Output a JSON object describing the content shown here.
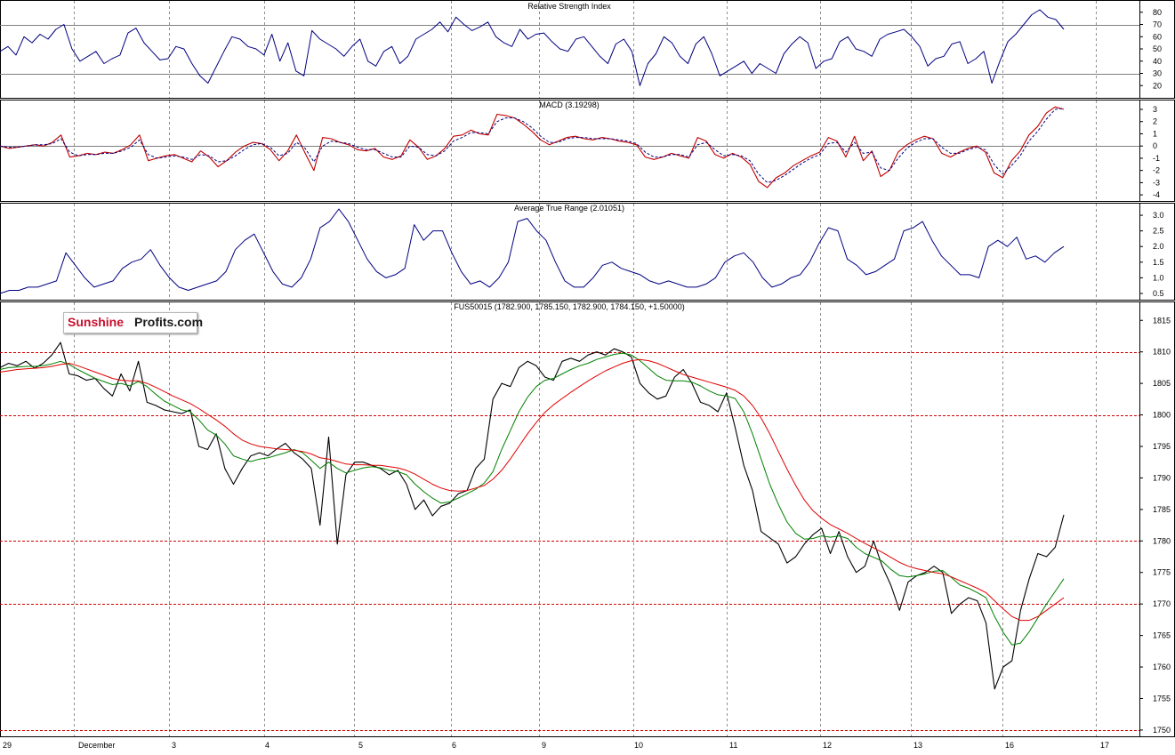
{
  "watermark": {
    "part1": "Sunshine",
    "part2": "Profits.com",
    "colors": {
      "part1": "#c8102e",
      "part2": "#1a1a1a"
    }
  },
  "colors": {
    "price": "#000000",
    "fast_ma": "#008000",
    "slow_ma": "#e00000",
    "indicator": "#000080",
    "signal": "#c00000",
    "ref_line": "#d00000",
    "grid": "#909090"
  },
  "chart_data": [
    {
      "type": "line",
      "title": "Relative Strength Index",
      "y_ticks": [
        "80",
        "70",
        "60",
        "50",
        "40",
        "30",
        "20"
      ],
      "ylim": [
        10,
        90
      ],
      "reference_lines": [
        70,
        30
      ],
      "series": [
        {
          "values": [
            48,
            52,
            45,
            60,
            55,
            62,
            58,
            66,
            70,
            50,
            40,
            44,
            48,
            38,
            42,
            45,
            63,
            67,
            55,
            48,
            41,
            42,
            52,
            50,
            38,
            28,
            22,
            35,
            48,
            60,
            58,
            52,
            50,
            45,
            62,
            40,
            55,
            32,
            28,
            65,
            58,
            54,
            50,
            44,
            52,
            58,
            40,
            36,
            48,
            52,
            38,
            44,
            58,
            62,
            66,
            72,
            64,
            76,
            70,
            65,
            68,
            72,
            60,
            55,
            52,
            66,
            58,
            62,
            63,
            56,
            50,
            48,
            58,
            60,
            52,
            44,
            38,
            54,
            58,
            48,
            20,
            38,
            46,
            60,
            55,
            44,
            38,
            54,
            60,
            46,
            28,
            32,
            36,
            40,
            30,
            38,
            34,
            30,
            46,
            54,
            60,
            55,
            34,
            40,
            42,
            56,
            60,
            50,
            48,
            44,
            58,
            62,
            64,
            66,
            60,
            52,
            36,
            42,
            44,
            54,
            56,
            38,
            42,
            48,
            22,
            40,
            56,
            62,
            70,
            78,
            82,
            76,
            74,
            66
          ]
        }
      ]
    },
    {
      "type": "line",
      "title": "MACD (3.19298)",
      "y_ticks": [
        "3",
        "2",
        "1",
        "0",
        "-1",
        "-2",
        "-3",
        "-4"
      ],
      "ylim": [
        -4.5,
        3.8
      ],
      "reference_lines": [
        0
      ],
      "series": [
        {
          "values": [
            0,
            -0.2,
            -0.1,
            0,
            0.1,
            0,
            0.3,
            0.9,
            -0.9,
            -0.8,
            -0.6,
            -0.7,
            -0.5,
            -0.6,
            -0.3,
            0.1,
            0.9,
            -1.2,
            -1.0,
            -0.8,
            -0.7,
            -1.0,
            -1.3,
            -0.4,
            -0.9,
            -1.7,
            -1.2,
            -0.5,
            0,
            0.3,
            0.2,
            -0.3,
            -1.2,
            -0.4,
            0.9,
            -0.6,
            -2.0,
            0.7,
            0.6,
            0.3,
            0.1,
            -0.3,
            -0.4,
            -0.2,
            -0.9,
            -1.1,
            -0.8,
            0.5,
            -0.1,
            -1.1,
            -0.8,
            -0.2,
            0.8,
            0.9,
            1.3,
            1.0,
            0.9,
            2.6,
            2.5,
            2.3,
            1.8,
            1.2,
            0.5,
            0.1,
            0.4,
            0.7,
            0.8,
            0.6,
            0.5,
            0.7,
            0.6,
            0.4,
            0.3,
            0.1,
            -0.9,
            -1.1,
            -0.9,
            -0.6,
            -0.8,
            -1.0,
            0.7,
            0.4,
            -0.7,
            -1.0,
            -0.6,
            -0.9,
            -1.5,
            -2.9,
            -3.4,
            -2.6,
            -2.2,
            -1.6,
            -1.2,
            -0.8,
            -0.5,
            0.7,
            0.4,
            -0.9,
            0.8,
            -1.2,
            -0.4,
            -2.5,
            -2.0,
            -0.5,
            0.1,
            0.5,
            0.8,
            0.6,
            -0.6,
            -0.9,
            -0.5,
            -0.2,
            0,
            -0.5,
            -2.2,
            -2.6,
            -1.2,
            -0.4,
            0.9,
            1.6,
            2.7,
            3.2,
            3.0
          ]
        },
        {
          "values": [
            0,
            -0.1,
            -0.1,
            0,
            0.1,
            0.1,
            0.2,
            0.6,
            -0.5,
            -0.8,
            -0.7,
            -0.7,
            -0.6,
            -0.6,
            -0.4,
            -0.1,
            0.5,
            -0.7,
            -1.0,
            -0.9,
            -0.8,
            -0.9,
            -1.1,
            -0.7,
            -0.8,
            -1.3,
            -1.2,
            -0.8,
            -0.3,
            0.1,
            0.2,
            -0.1,
            -0.8,
            -0.6,
            0.3,
            -0.2,
            -1.3,
            0,
            0.4,
            0.3,
            0.2,
            -0.1,
            -0.3,
            -0.3,
            -0.6,
            -0.9,
            -0.9,
            0,
            -0.1,
            -0.7,
            -0.8,
            -0.4,
            0.4,
            0.7,
            1.1,
            1.1,
            1.0,
            2.0,
            2.3,
            2.3,
            2.0,
            1.5,
            0.8,
            0.3,
            0.3,
            0.6,
            0.7,
            0.7,
            0.6,
            0.6,
            0.6,
            0.5,
            0.4,
            0.2,
            -0.5,
            -0.9,
            -0.9,
            -0.7,
            -0.7,
            -0.9,
            0.1,
            0.3,
            -0.3,
            -0.8,
            -0.7,
            -0.8,
            -1.2,
            -2.3,
            -3.0,
            -2.8,
            -2.4,
            -1.9,
            -1.4,
            -1.0,
            -0.7,
            0.2,
            0.3,
            -0.5,
            0.3,
            -0.6,
            -0.5,
            -1.8,
            -2.0,
            -1.0,
            -0.2,
            0.3,
            0.6,
            0.6,
            -0.1,
            -0.6,
            -0.6,
            -0.3,
            -0.1,
            -0.3,
            -1.5,
            -2.3,
            -1.6,
            -0.8,
            0.4,
            1.2,
            2.2,
            3.0,
            3.1
          ]
        }
      ]
    },
    {
      "type": "line",
      "title": "Average True Range (2.01051)",
      "y_ticks": [
        "3.0",
        "2.5",
        "2.0",
        "1.5",
        "1.0",
        "0.5"
      ],
      "ylim": [
        0.3,
        3.4
      ],
      "series": [
        {
          "values": [
            0.5,
            0.6,
            0.6,
            0.7,
            0.7,
            0.8,
            0.9,
            1.8,
            1.4,
            1.0,
            0.7,
            0.8,
            0.9,
            1.3,
            1.5,
            1.6,
            1.9,
            1.4,
            1.0,
            0.7,
            0.6,
            0.7,
            0.8,
            0.9,
            1.2,
            1.9,
            2.2,
            2.4,
            1.8,
            1.2,
            0.8,
            0.7,
            1.0,
            1.6,
            2.6,
            2.8,
            3.2,
            2.8,
            2.2,
            1.6,
            1.2,
            1.0,
            1.1,
            1.3,
            2.7,
            2.2,
            2.5,
            2.5,
            1.8,
            1.2,
            0.8,
            0.9,
            0.7,
            1.0,
            1.5,
            2.8,
            2.9,
            2.5,
            2.2,
            1.5,
            0.9,
            0.7,
            0.7,
            1.0,
            1.4,
            1.5,
            1.3,
            1.2,
            1.1,
            0.9,
            0.8,
            0.9,
            0.8,
            0.7,
            0.7,
            0.8,
            1.0,
            1.5,
            1.7,
            1.8,
            1.5,
            1.0,
            0.7,
            0.8,
            1.0,
            1.1,
            1.5,
            2.1,
            2.6,
            2.5,
            1.6,
            1.4,
            1.1,
            1.2,
            1.4,
            1.6,
            2.5,
            2.6,
            2.8,
            2.2,
            1.7,
            1.4,
            1.1,
            1.1,
            1.0,
            2.0,
            2.2,
            2.0,
            2.3,
            1.6,
            1.7,
            1.5,
            1.8,
            2.0
          ]
        }
      ]
    },
    {
      "type": "line",
      "title": "FUS50015 (1782.900, 1785.150, 1782.900, 1784.150, +1.50000)",
      "x_labels": [
        "29",
        "December",
        "3",
        "4",
        "5",
        "6",
        "9",
        "10",
        "11",
        "12",
        "13",
        "16",
        "17"
      ],
      "y_ticks": [
        "1815",
        "1810",
        "1805",
        "1800",
        "1795",
        "1790",
        "1785",
        "1780",
        "1775",
        "1770",
        "1765",
        "1760",
        "1755",
        "1750"
      ],
      "ylim": [
        1749,
        1818
      ],
      "reference_lines": [
        1810,
        1800,
        1780,
        1770,
        1750
      ],
      "series": [
        {
          "values": [
            1807.5,
            1808.2,
            1807.8,
            1808.5,
            1807.4,
            1808.2,
            1809.5,
            1811.5,
            1806.5,
            1806.2,
            1805.5,
            1805.8,
            1804.2,
            1803.0,
            1806.5,
            1803.8,
            1808.5,
            1802.0,
            1801.5,
            1800.8,
            1800.5,
            1800.2,
            1800.8,
            1795.0,
            1794.5,
            1797.0,
            1791.5,
            1789.0,
            1791.5,
            1793.5,
            1794.0,
            1793.5,
            1794.6,
            1795.5,
            1794.0,
            1793.0,
            1791.5,
            1782.5,
            1796.5,
            1779.5,
            1790.5,
            1792.5,
            1792.5,
            1792.0,
            1791.5,
            1790.5,
            1791.2,
            1789.0,
            1785.0,
            1786.5,
            1784.0,
            1785.5,
            1786.0,
            1787.5,
            1788.0,
            1791.5,
            1793.0,
            1802.5,
            1805.0,
            1804.5,
            1807.5,
            1808.5,
            1807.8,
            1806.0,
            1805.5,
            1808.5,
            1809.0,
            1808.5,
            1809.5,
            1810.0,
            1809.5,
            1810.5,
            1810.0,
            1809.2,
            1805.0,
            1803.5,
            1802.5,
            1803.0,
            1806.0,
            1807.2,
            1805.0,
            1802.0,
            1801.5,
            1800.5,
            1803.5,
            1798.0,
            1792.0,
            1788.0,
            1781.5,
            1780.5,
            1779.5,
            1776.5,
            1777.5,
            1779.5,
            1781.0,
            1782.0,
            1778.0,
            1781.5,
            1777.5,
            1775.0,
            1776.0,
            1780.0,
            1776.0,
            1773.0,
            1769.0,
            1773.5,
            1774.5,
            1775.0,
            1776.0,
            1775.0,
            1768.5,
            1770.0,
            1771.0,
            1770.5,
            1767.0,
            1756.5,
            1760.0,
            1761.0,
            1769.0,
            1774.0,
            1778.0,
            1777.5,
            1779.0,
            1784.15
          ]
        },
        {
          "values": [
            1807.2,
            1807.5,
            1807.6,
            1807.7,
            1807.7,
            1807.8,
            1808.1,
            1808.5,
            1808.0,
            1807.2,
            1806.5,
            1805.8,
            1805.3,
            1804.8,
            1805.0,
            1804.6,
            1805.3,
            1804.5,
            1803.3,
            1802.2,
            1801.5,
            1800.8,
            1800.5,
            1799.2,
            1797.6,
            1796.8,
            1795.4,
            1793.5,
            1793.0,
            1792.6,
            1793.0,
            1793.2,
            1793.6,
            1794.0,
            1794.5,
            1794.0,
            1792.8,
            1791.5,
            1792.5,
            1791.5,
            1790.8,
            1791.2,
            1791.6,
            1791.8,
            1791.6,
            1791.2,
            1791.0,
            1790.5,
            1789.0,
            1787.8,
            1786.8,
            1786.0,
            1786.2,
            1786.8,
            1787.5,
            1788.2,
            1789.2,
            1791.0,
            1794.5,
            1797.5,
            1800.5,
            1802.8,
            1804.5,
            1805.5,
            1805.8,
            1806.5,
            1807.2,
            1807.8,
            1808.2,
            1808.8,
            1809.2,
            1809.6,
            1809.8,
            1809.5,
            1808.6,
            1807.4,
            1806.2,
            1805.5,
            1805.4,
            1805.4,
            1805.2,
            1804.6,
            1803.8,
            1803.2,
            1803.0,
            1802.6,
            1800.5,
            1797.0,
            1793.0,
            1789.0,
            1785.8,
            1783.0,
            1781.2,
            1780.3,
            1780.4,
            1780.8,
            1780.6,
            1780.8,
            1780.4,
            1779.0,
            1778.0,
            1777.4,
            1776.8,
            1775.5,
            1774.5,
            1774.3,
            1774.5,
            1774.8,
            1775.2,
            1775.3,
            1774.2,
            1773.0,
            1772.5,
            1771.8,
            1771.0,
            1768.0,
            1765.5,
            1763.5,
            1763.8,
            1765.6,
            1767.8,
            1770.0,
            1772.0,
            1774.0
          ]
        },
        {
          "values": [
            1806.8,
            1807.0,
            1807.2,
            1807.3,
            1807.4,
            1807.5,
            1807.7,
            1808.0,
            1808.2,
            1807.8,
            1807.3,
            1806.8,
            1806.3,
            1805.8,
            1805.5,
            1805.4,
            1805.4,
            1805.0,
            1804.4,
            1803.7,
            1803.0,
            1802.4,
            1801.8,
            1801.0,
            1800.1,
            1799.2,
            1798.2,
            1797.0,
            1796.0,
            1795.4,
            1795.0,
            1794.8,
            1794.6,
            1794.5,
            1794.4,
            1794.2,
            1793.8,
            1793.2,
            1793.0,
            1792.6,
            1792.2,
            1792.1,
            1792.1,
            1792.0,
            1792.0,
            1791.8,
            1791.6,
            1791.2,
            1790.6,
            1789.8,
            1789.0,
            1788.4,
            1788.0,
            1787.9,
            1788.0,
            1788.4,
            1788.8,
            1789.8,
            1791.2,
            1793.0,
            1795.0,
            1797.0,
            1798.8,
            1800.4,
            1801.6,
            1802.6,
            1803.6,
            1804.5,
            1805.4,
            1806.2,
            1807.0,
            1807.6,
            1808.2,
            1808.6,
            1808.8,
            1808.6,
            1808.2,
            1807.6,
            1807.0,
            1806.4,
            1806.0,
            1805.6,
            1805.2,
            1804.8,
            1804.4,
            1803.9,
            1803.0,
            1801.5,
            1799.5,
            1797.0,
            1794.2,
            1791.4,
            1788.8,
            1786.5,
            1784.8,
            1783.6,
            1782.6,
            1781.9,
            1781.2,
            1780.4,
            1779.6,
            1778.9,
            1778.2,
            1777.4,
            1776.6,
            1776.0,
            1775.6,
            1775.3,
            1775.0,
            1774.8,
            1774.3,
            1773.7,
            1773.1,
            1772.5,
            1771.8,
            1770.5,
            1769.2,
            1768.0,
            1767.4,
            1767.4,
            1768.0,
            1769.0,
            1770.0,
            1771.0
          ]
        }
      ]
    }
  ]
}
